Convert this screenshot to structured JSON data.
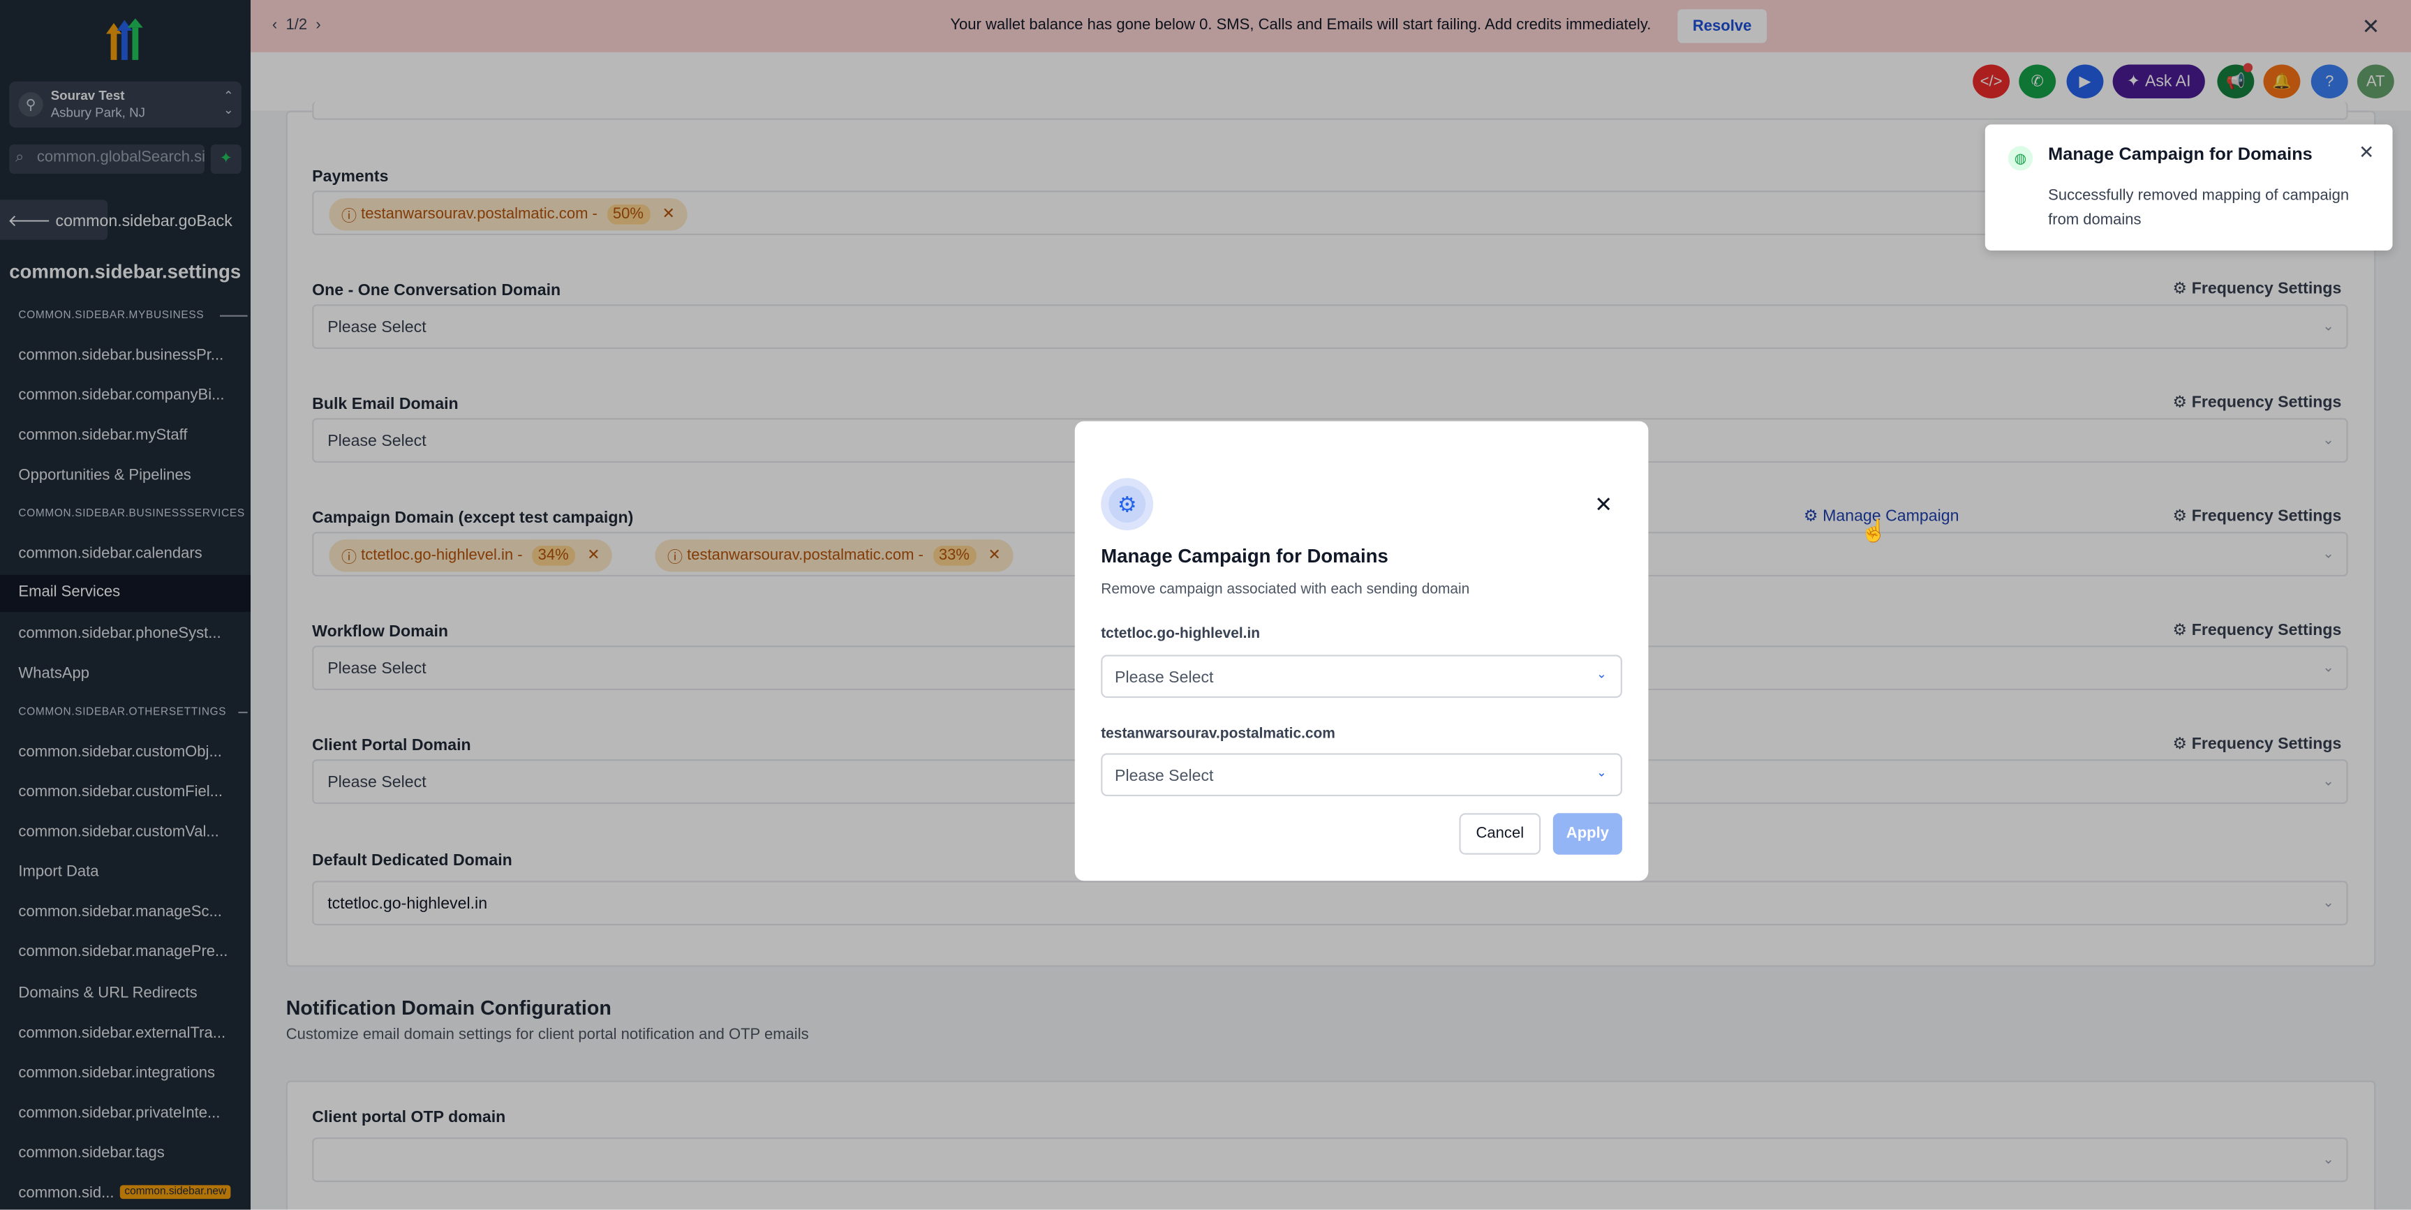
{
  "sidebar": {
    "location_name": "Sourav Test",
    "location_addr": "Asbury Park, NJ",
    "search_placeholder": "common.globalSearch.sidebar",
    "go_back": "common.sidebar.goBack",
    "settings_title": "common.sidebar.settings",
    "section_mybusiness": "COMMON.SIDEBAR.MYBUSINESS",
    "section_businessservices": "COMMON.SIDEBAR.BUSINESSSERVICES",
    "section_othersettings": "COMMON.SIDEBAR.OTHERSETTINGS",
    "items": [
      "common.sidebar.businessPr...",
      "common.sidebar.companyBi...",
      "common.sidebar.myStaff",
      "Opportunities & Pipelines",
      "common.sidebar.calendars",
      "Email Services",
      "common.sidebar.phoneSyst...",
      "WhatsApp",
      "common.sidebar.customObj...",
      "common.sidebar.customFiel...",
      "common.sidebar.customVal...",
      "Import Data",
      "common.sidebar.manageSc...",
      "common.sidebar.managePre...",
      "Domains & URL Redirects",
      "common.sidebar.externalTra...",
      "common.sidebar.integrations",
      "common.sidebar.privateInte...",
      "common.sidebar.tags",
      "common.sid..."
    ],
    "new_badge": "common.sidebar.new"
  },
  "banner": {
    "pager": "1/2",
    "message": "Your wallet balance has gone below 0. SMS, Calls and Emails will start failing. Add credits immediately.",
    "resolve": "Resolve"
  },
  "header": {
    "ask_ai": "Ask AI",
    "avatar": "AT",
    "colors": {
      "code": "#ef2b2b",
      "phone": "#16a34a",
      "video": "#2563eb",
      "megaphone": "#15803d",
      "bell": "#f97316",
      "help": "#3b82f6",
      "avatar": "#65a36b"
    }
  },
  "form": {
    "payments_label": "Payments",
    "payments_chip_domain": "testanwarsourav.postalmatic.com -",
    "payments_chip_pct": "50%",
    "one_one_label": "One - One Conversation Domain",
    "bulk_label": "Bulk Email Domain",
    "campaign_label": "Campaign Domain (except test campaign)",
    "campaign_chip1_domain": "tctetloc.go-highlevel.in -",
    "campaign_chip1_pct": "34%",
    "campaign_chip2_domain": "testanwarsourav.postalmatic.com -",
    "campaign_chip2_pct": "33%",
    "manage_campaign": "Manage Campaign",
    "workflow_label": "Workflow Domain",
    "client_portal_label": "Client Portal Domain",
    "default_dedicated_label": "Default Dedicated Domain",
    "default_dedicated_value": "tctetloc.go-highlevel.in",
    "please_select": "Please Select",
    "frequency_settings": "Frequency Settings"
  },
  "notification": {
    "heading": "Notification Domain Configuration",
    "description": "Customize email domain settings for client portal notification and OTP emails",
    "otp_label": "Client portal OTP domain"
  },
  "modal": {
    "title": "Manage Campaign for Domains",
    "description": "Remove campaign associated with each sending domain",
    "domain1": "tctetloc.go-highlevel.in",
    "domain2": "testanwarsourav.postalmatic.com",
    "select_placeholder": "Please Select",
    "cancel": "Cancel",
    "apply": "Apply"
  },
  "toast": {
    "title": "Manage Campaign for Domains",
    "body": "Successfully removed mapping of campaign from domains"
  }
}
